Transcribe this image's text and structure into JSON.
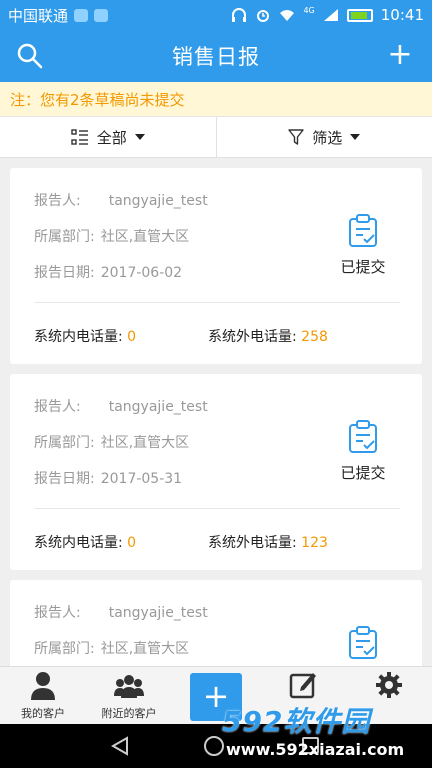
{
  "status_bar": {
    "carrier": "中国联通",
    "network": "4G",
    "time": "10:41",
    "icons": [
      "wifi-signal-icon",
      "message-icon",
      "headphones-icon",
      "alarm-icon",
      "wifi-icon",
      "cell-signal-icon",
      "battery-icon"
    ]
  },
  "app_bar": {
    "title": "销售日报",
    "left_icon": "search-icon",
    "right_label": "+"
  },
  "notice": "注：您有2条草稿尚未提交",
  "filters": {
    "all_label": "全部",
    "filter_label": "筛选"
  },
  "labels": {
    "reporter": "报告人:",
    "department": "所属部门:",
    "date": "报告日期:",
    "internal_calls": "系统内电话量:",
    "external_calls": "系统外电话量:"
  },
  "reports": [
    {
      "reporter": "tangyajie_test",
      "department": "社区,直管大区",
      "date": "2017-06-02",
      "status": "已提交",
      "internal": "0",
      "external": "258"
    },
    {
      "reporter": "tangyajie_test",
      "department": "社区,直管大区",
      "date": "2017-05-31",
      "status": "已提交",
      "internal": "0",
      "external": "123"
    },
    {
      "reporter": "tangyajie_test",
      "department": "社区,直管大区",
      "date": "",
      "status": "",
      "internal": "",
      "external": ""
    }
  ],
  "tab_bar": {
    "my_customers": "我的客户",
    "nearby_customers": "附近的客户",
    "add": "+"
  },
  "watermark": {
    "logo": "592软件园",
    "url": "www.592xiazai.com"
  },
  "colors": {
    "primary": "#2f9bea",
    "accent": "#f39800",
    "notice_bg": "#fff7d6"
  }
}
